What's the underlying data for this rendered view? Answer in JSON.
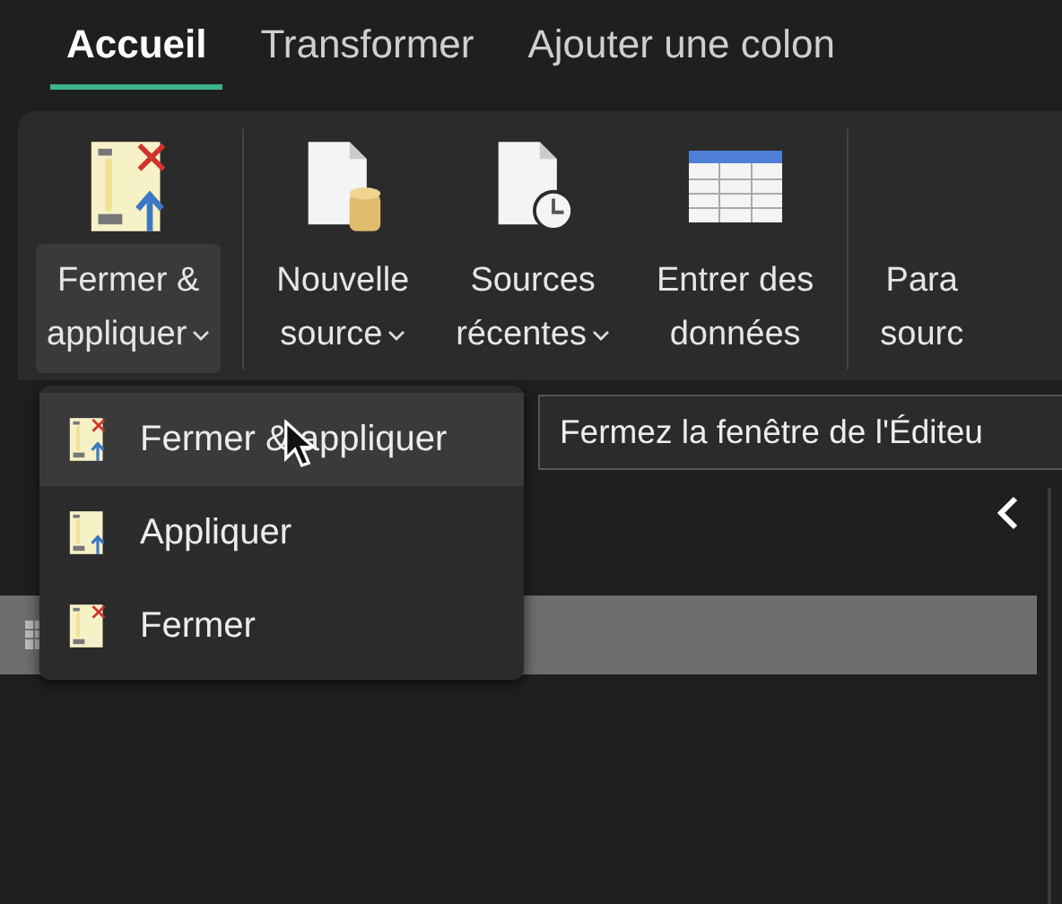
{
  "tabs": [
    {
      "label": "Accueil",
      "selected": true
    },
    {
      "label": "Transformer",
      "selected": false
    },
    {
      "label": "Ajouter une colon",
      "selected": false
    }
  ],
  "ribbon": {
    "groups": [
      {
        "buttons": [
          {
            "kind": "close-apply",
            "lines": [
              "Fermer &",
              "appliquer"
            ],
            "dropdown": true,
            "expanded": true
          }
        ]
      },
      {
        "buttons": [
          {
            "kind": "new-source",
            "lines": [
              "Nouvelle",
              "source"
            ],
            "dropdown": true,
            "expanded": false
          },
          {
            "kind": "recent-sources",
            "lines": [
              "Sources",
              "récentes"
            ],
            "dropdown": true,
            "expanded": false
          },
          {
            "kind": "enter-data",
            "lines": [
              "Entrer des",
              "données"
            ],
            "dropdown": false,
            "expanded": false
          }
        ]
      },
      {
        "buttons": [
          {
            "kind": "cut",
            "lines": [
              "Para",
              "sourc"
            ],
            "dropdown": false,
            "expanded": false
          }
        ]
      }
    ]
  },
  "menu": {
    "items": [
      {
        "label": "Fermer & appliquer",
        "kind": "close-apply",
        "selected": true
      },
      {
        "label": "Appliquer",
        "kind": "apply",
        "selected": false
      },
      {
        "label": "Fermer",
        "kind": "close",
        "selected": false
      }
    ]
  },
  "tooltip": {
    "text": "Fermez la fenêtre de l'Éditeu"
  },
  "queries": {
    "rows": [
      {
        "selected": true
      }
    ]
  }
}
